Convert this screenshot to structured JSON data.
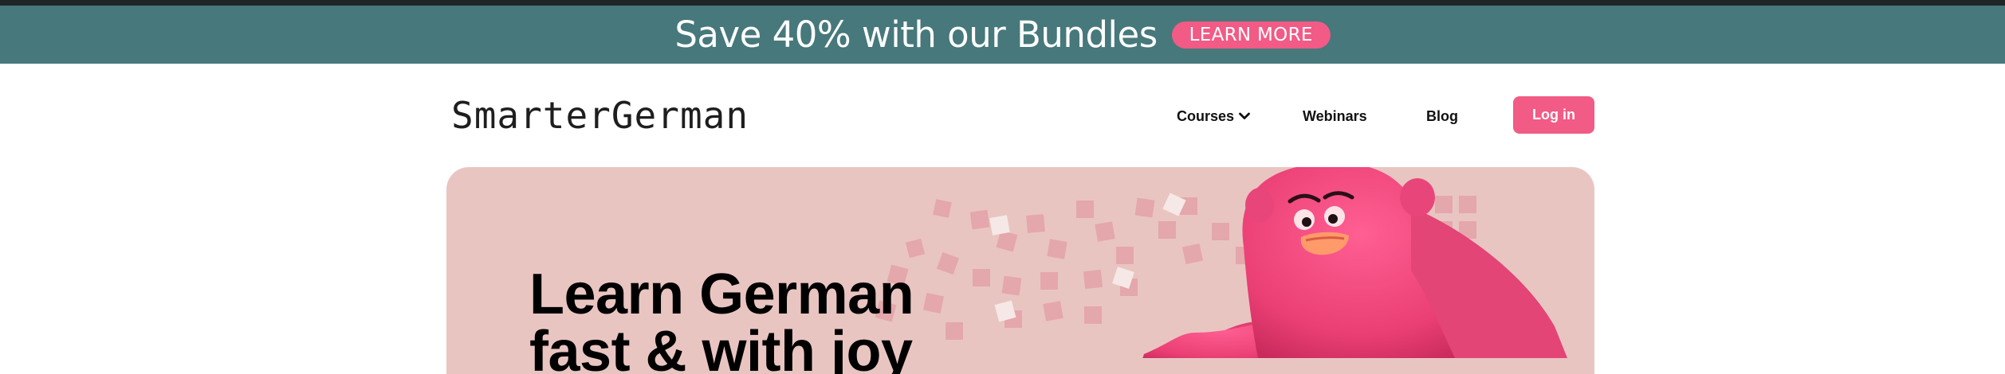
{
  "promo": {
    "text": "Save 40% with our Bundles",
    "button_label": "LEARN MORE"
  },
  "header": {
    "logo_text": "SmarterGerman",
    "nav": {
      "courses_label": "Courses",
      "webinars_label": "Webinars",
      "blog_label": "Blog"
    },
    "login_label": "Log in"
  },
  "hero": {
    "title_line1": "Learn German",
    "title_line2": "fast & with joy",
    "mascot_icon": "pink-furry-monster-mascot"
  },
  "colors": {
    "promo_bg": "#47787b",
    "accent": "#f15b86",
    "hero_bg": "#e9c5c1"
  }
}
